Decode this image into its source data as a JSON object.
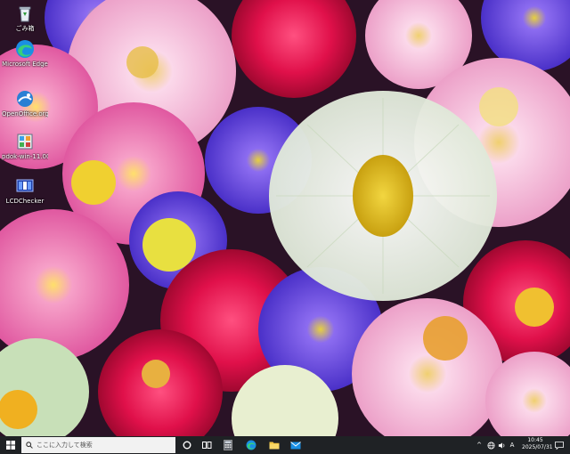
{
  "desktop": {
    "icons": [
      {
        "label": "ごみ箱",
        "icon": "recycle-bin-icon"
      },
      {
        "label": "Microsoft Edge",
        "icon": "edge-icon"
      },
      {
        "label": "OpenOffice.org 4.1",
        "icon": "openoffice-icon"
      },
      {
        "label": "pdok-win-11.0000 (ファイル)",
        "icon": "installer-icon"
      },
      {
        "label": "LCDChecker",
        "icon": "lcdchecker-icon"
      }
    ]
  },
  "taskbar": {
    "search_placeholder": "ここに入力して検索",
    "pinned": [
      {
        "name": "cortana",
        "icon": "cortana-icon"
      },
      {
        "name": "task-view",
        "icon": "task-view-icon"
      },
      {
        "name": "calculator",
        "icon": "calculator-icon"
      },
      {
        "name": "edge",
        "icon": "edge-icon"
      },
      {
        "name": "file-explorer",
        "icon": "folder-icon"
      },
      {
        "name": "mail",
        "icon": "mail-icon"
      }
    ],
    "tray": {
      "chevron": "^",
      "ime_mode": "A",
      "time": "10:45",
      "date": "2025/07/31"
    },
    "colors": {
      "taskbar_bg": "#1f2225",
      "search_bg": "#f2f2f2",
      "windows_blue": "#1a8fe3"
    }
  }
}
